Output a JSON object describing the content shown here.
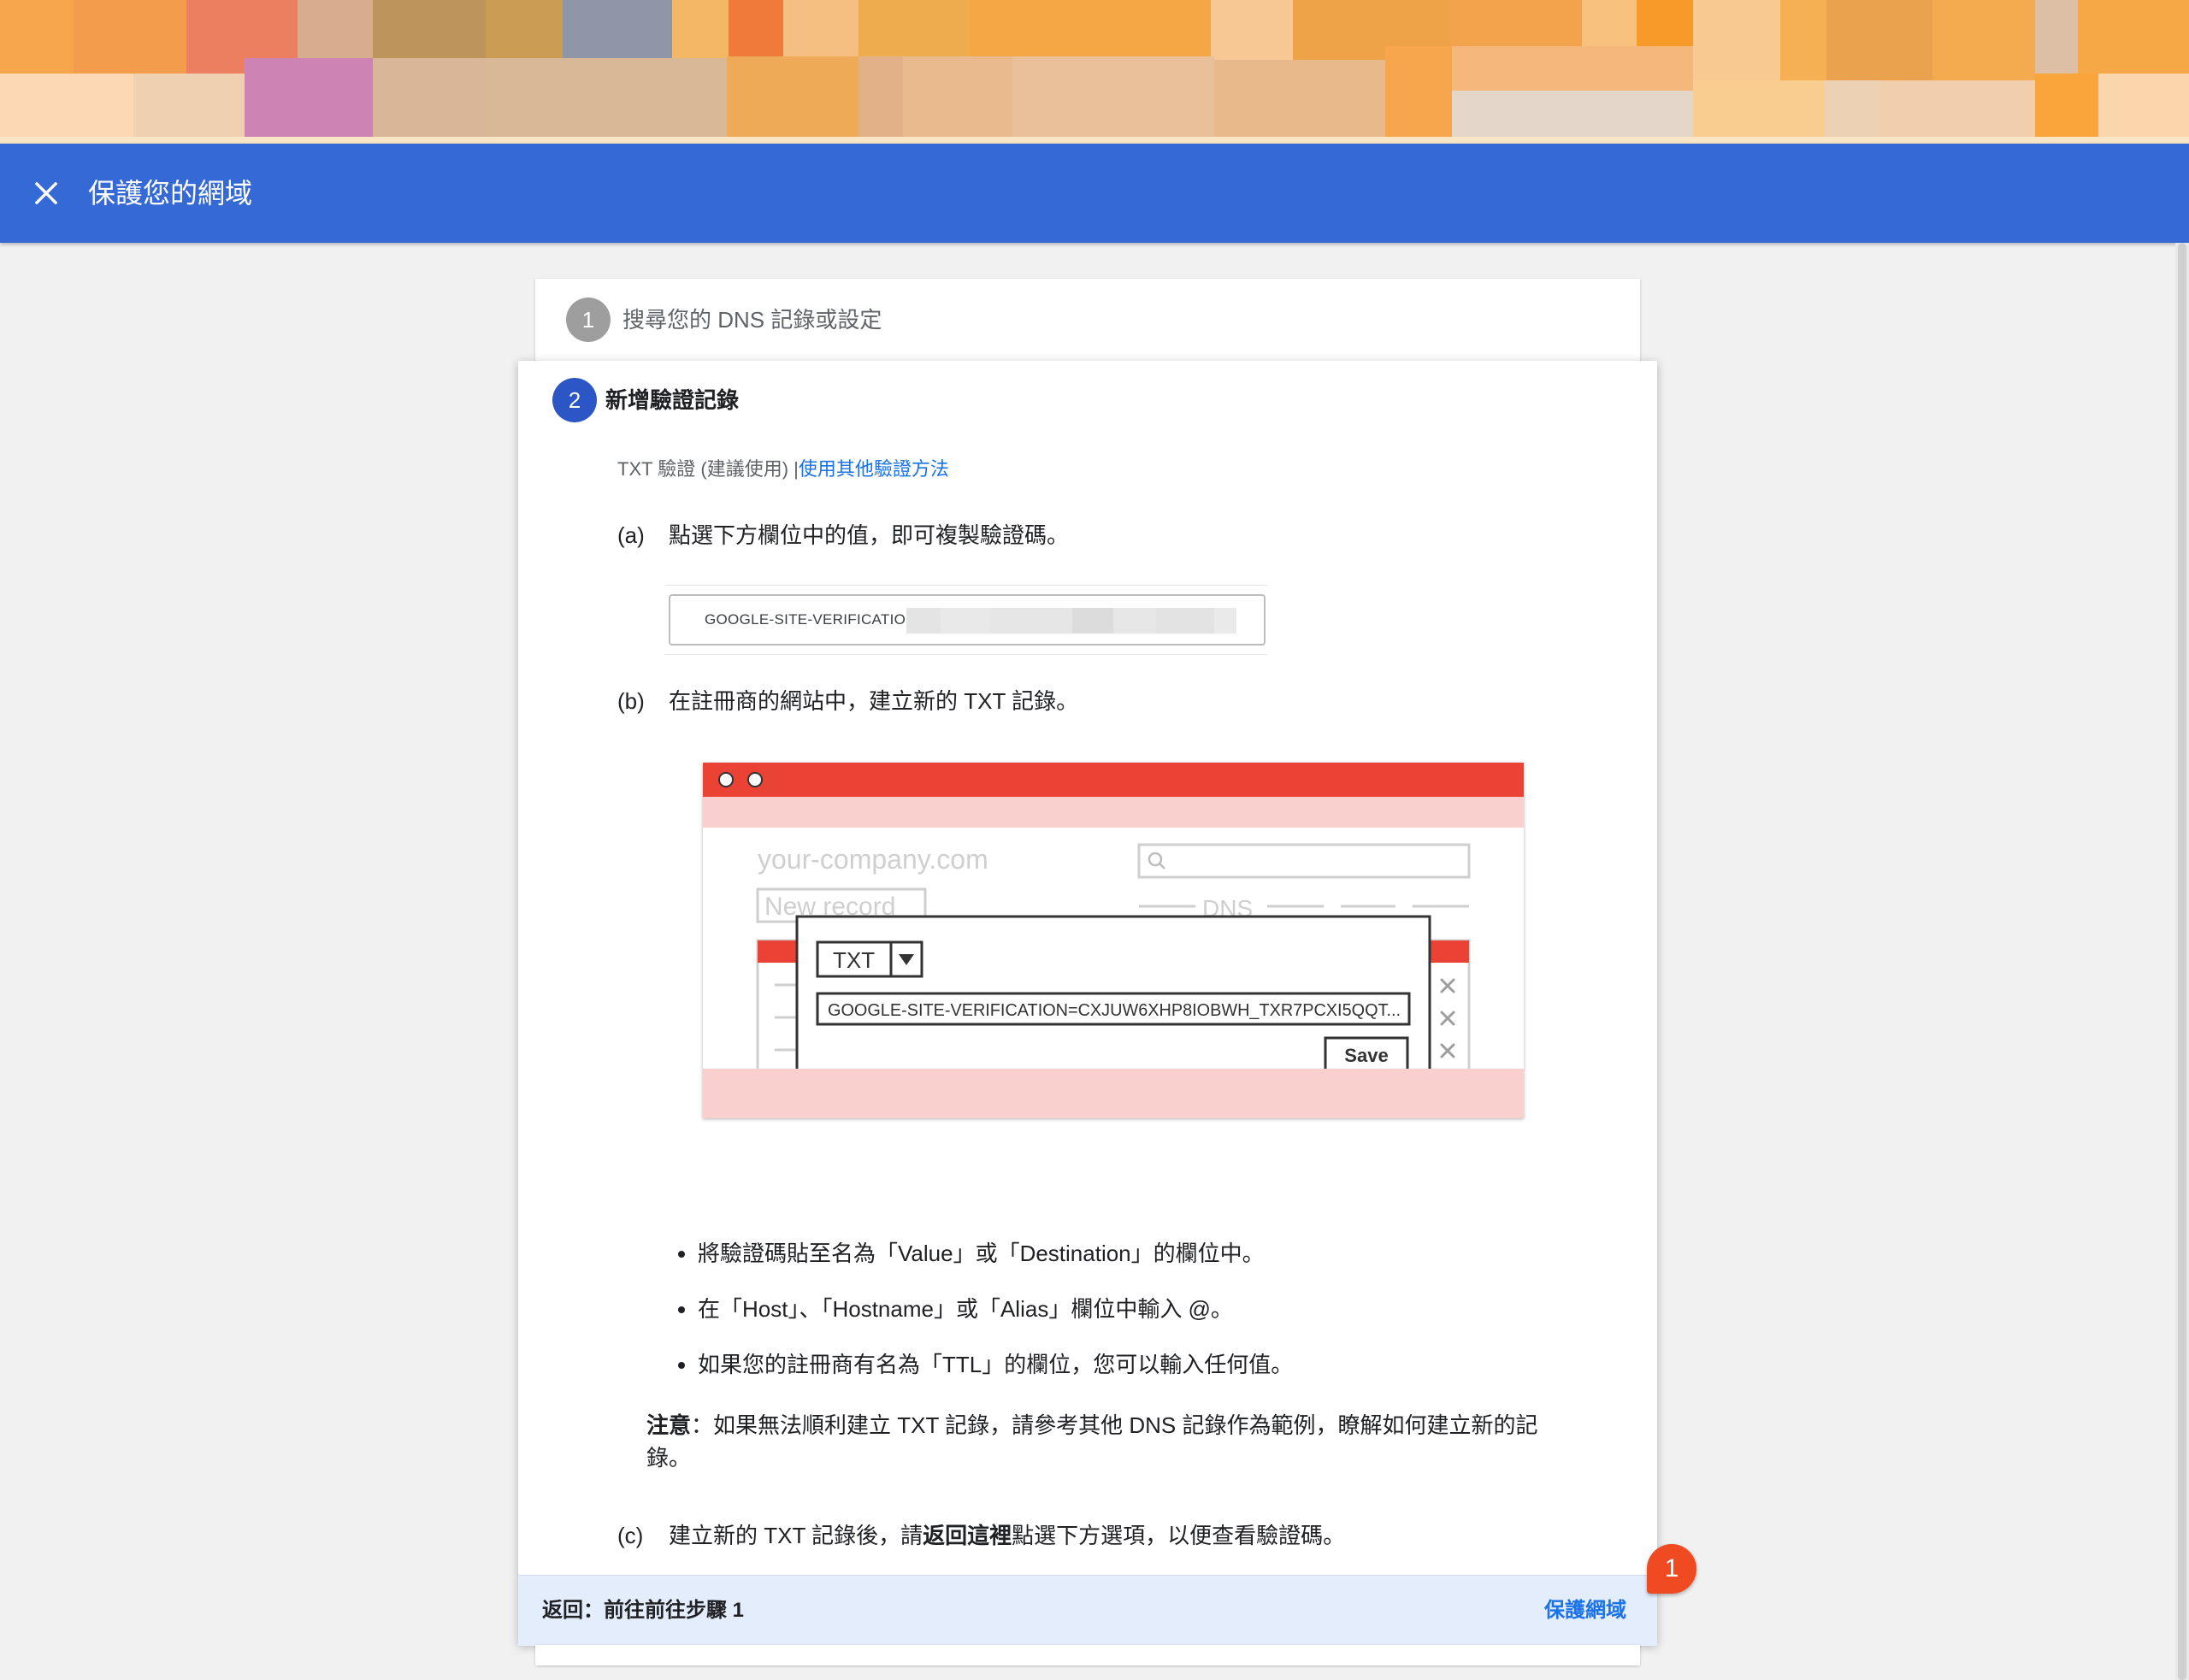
{
  "app_bar": {
    "title": "保護您的網域"
  },
  "step1": {
    "number": "1",
    "label": "搜尋您的 DNS 記錄或設定"
  },
  "step2": {
    "number": "2",
    "label": "新增驗證記錄",
    "method_text": "TXT 驗證 (建議使用) |",
    "method_link": "使用其他驗證方法",
    "a": {
      "letter": "(a)",
      "text": "點選下方欄位中的值，即可複製驗證碼。"
    },
    "code_prefix": "GOOGLE-SITE-VERIFICATION=",
    "b": {
      "letter": "(b)",
      "text": "在註冊商的網站中，建立新的 TXT 記錄。"
    },
    "illustration": {
      "domain": "your-company.com",
      "new_record": "New record",
      "dns": "DNS",
      "type": "TXT",
      "txt_value": "GOOGLE-SITE-VERIFICATION=CXJUW6XHP8IOBWH_TXR7PCXI5QQT...",
      "save": "Save"
    },
    "bullets": [
      "將驗證碼貼至名為「Value」或「Destination」的欄位中。",
      "在「Host」、「Hostname」或「Alias」欄位中輸入 @。",
      "如果您的註冊商有名為「TTL」的欄位，您可以輸入任何值。"
    ],
    "note_label": "注意",
    "note_text": "：如果無法順利建立 TXT 記錄，請參考其他 DNS 記錄作為範例，瞭解如何建立新的記錄。",
    "c": {
      "letter": "(c)",
      "text_before": "建立新的 TXT 記錄後，請",
      "text_bold": "返回這裡",
      "text_after": "點選下方選項，以便查看驗證碼。"
    }
  },
  "footer": {
    "back": "返回：前往前往步驟 1",
    "protect": "保護網域"
  },
  "notification_badge": "1",
  "colors": {
    "app_bar": "#3569d6",
    "step_active": "#2c56c6",
    "step_inactive": "#9e9e9e",
    "link": "#1a73e8",
    "footer_bg": "#e3edfc",
    "badge": "#f04a23",
    "illustration_red": "#ea4335",
    "illustration_pink": "#f9d0cd"
  }
}
